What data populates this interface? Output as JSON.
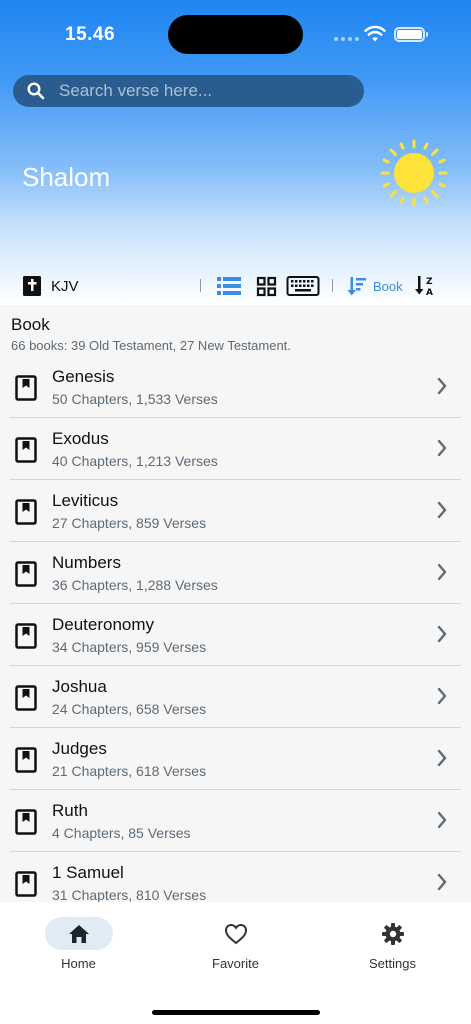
{
  "status": {
    "time": "15.46"
  },
  "search": {
    "placeholder": "Search verse here..."
  },
  "greeting": "Shalom",
  "toolbar": {
    "version": "KJV",
    "sort_label": "Book"
  },
  "section": {
    "title": "Book",
    "subtitle": "66 books: 39 Old Testament, 27 New Testament."
  },
  "books": [
    {
      "name": "Genesis",
      "meta": "50 Chapters, 1,533 Verses"
    },
    {
      "name": "Exodus",
      "meta": "40 Chapters, 1,213 Verses"
    },
    {
      "name": "Leviticus",
      "meta": "27 Chapters, 859 Verses"
    },
    {
      "name": "Numbers",
      "meta": "36 Chapters, 1,288 Verses"
    },
    {
      "name": "Deuteronomy",
      "meta": "34 Chapters, 959 Verses"
    },
    {
      "name": "Joshua",
      "meta": "24 Chapters, 658 Verses"
    },
    {
      "name": "Judges",
      "meta": "21 Chapters, 618 Verses"
    },
    {
      "name": "Ruth",
      "meta": "4 Chapters, 85 Verses"
    },
    {
      "name": "1 Samuel",
      "meta": "31 Chapters, 810 Verses"
    }
  ],
  "nav": {
    "home": "Home",
    "favorite": "Favorite",
    "settings": "Settings"
  },
  "colors": {
    "accent": "#3b8ee8",
    "header_top": "#1e86f3",
    "search_bg": "#2b5c8f",
    "sun": "#fde23a"
  },
  "icons": [
    "search-icon",
    "bible-icon",
    "list-view-icon",
    "grid-view-icon",
    "keyboard-icon",
    "sort-icon",
    "sort-az-icon",
    "bookmark-book-icon",
    "chevron-right-icon",
    "home-icon",
    "heart-icon",
    "gear-icon",
    "sun-icon"
  ]
}
